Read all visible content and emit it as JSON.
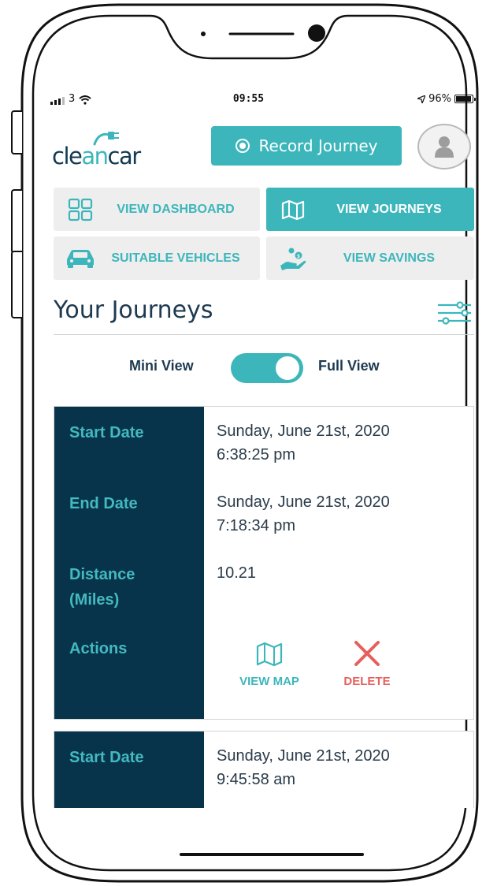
{
  "status_bar": {
    "signal": "3",
    "time": "09:55",
    "battery": "96%"
  },
  "header": {
    "logo": {
      "prefix": "cle",
      "highlight": "an",
      "suffix": "car"
    },
    "record_button": "Record Journey",
    "avatar_icon": "user-icon"
  },
  "nav": {
    "dashboard": {
      "label": "VIEW DASHBOARD",
      "icon": "grid-icon"
    },
    "journeys": {
      "label": "VIEW JOURNEYS",
      "icon": "map-icon"
    },
    "vehicles": {
      "label": "SUITABLE VEHICLES",
      "icon": "car-icon"
    },
    "savings": {
      "label": "VIEW SAVINGS",
      "icon": "savings-hand-icon"
    }
  },
  "page": {
    "title": "Your Journeys",
    "filter_icon": "sliders-icon"
  },
  "view_toggle": {
    "left_label": "Mini View",
    "right_label": "Full View",
    "state": "Full View"
  },
  "journeys": [
    {
      "start_label": "Start Date",
      "start_date": "Sunday, June 21st, 2020",
      "start_time": "6:38:25 pm",
      "end_label": "End Date",
      "end_date": "Sunday, June 21st, 2020",
      "end_time": "7:18:34 pm",
      "distance_label_1": "Distance",
      "distance_label_2": "(Miles)",
      "distance": "10.21",
      "actions_label": "Actions",
      "view_map": "VIEW MAP",
      "delete": "DELETE"
    },
    {
      "start_label": "Start Date",
      "start_date": "Sunday, June 21st, 2020",
      "start_time": "9:45:58 am"
    }
  ],
  "colors": {
    "teal": "#3db6bb",
    "navy": "#08344b",
    "red": "#e5605d",
    "text": "#1e3a50"
  }
}
